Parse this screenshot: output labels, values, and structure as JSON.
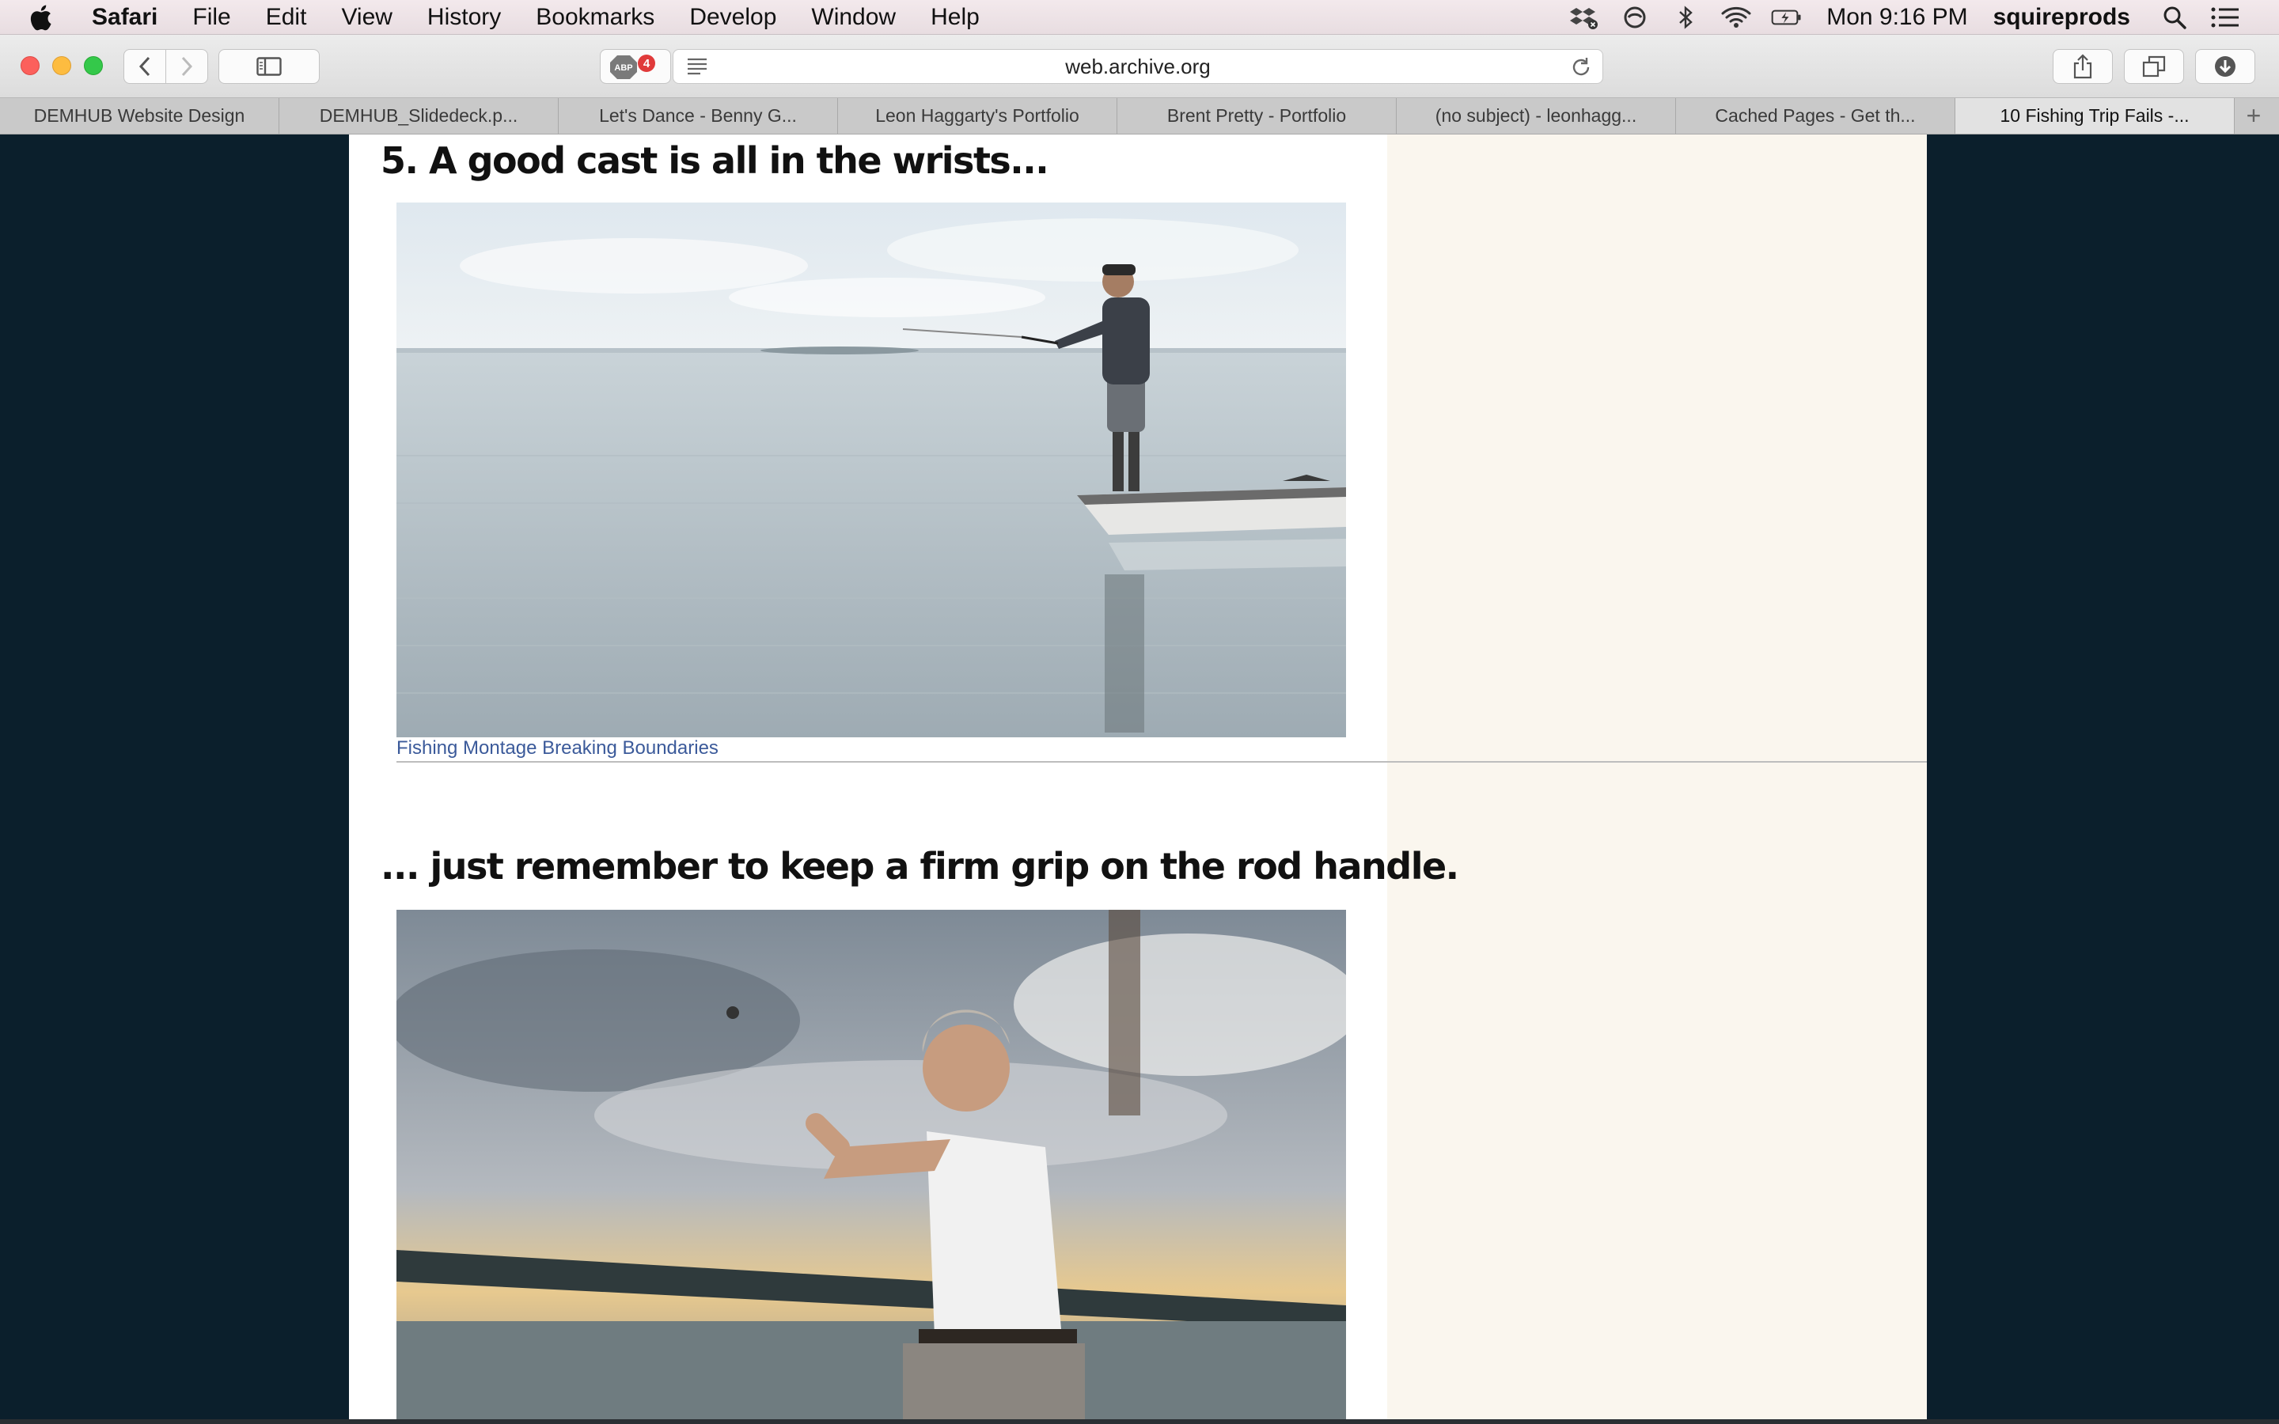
{
  "menubar": {
    "app": "Safari",
    "items": [
      "File",
      "Edit",
      "View",
      "History",
      "Bookmarks",
      "Develop",
      "Window",
      "Help"
    ],
    "clock": "Mon 9:16 PM",
    "user": "squireprods"
  },
  "toolbar": {
    "abp_count": "4",
    "url": "web.archive.org"
  },
  "tabs": [
    {
      "label": "DEMHUB Website Design"
    },
    {
      "label": "DEMHUB_Slidedeck.p..."
    },
    {
      "label": "Let's Dance - Benny G..."
    },
    {
      "label": "Leon Haggarty's Portfolio"
    },
    {
      "label": "Brent Pretty - Portfolio"
    },
    {
      "label": "(no subject) - leonhagg..."
    },
    {
      "label": "Cached Pages - Get th..."
    },
    {
      "label": "10 Fishing Trip Fails -..."
    }
  ],
  "tab_plus": "+",
  "article": {
    "heading_5": "5. A good cast is all in the wrists...",
    "caption": "Fishing Montage Breaking Boundaries",
    "heading_grip": "...  just remember to keep a firm grip on the rod handle."
  },
  "colors": {
    "page_background": "#0b1f2c",
    "content_white": "#ffffff",
    "sidebar_cream": "#faf6ee",
    "link_blue": "#3b5a9a"
  }
}
